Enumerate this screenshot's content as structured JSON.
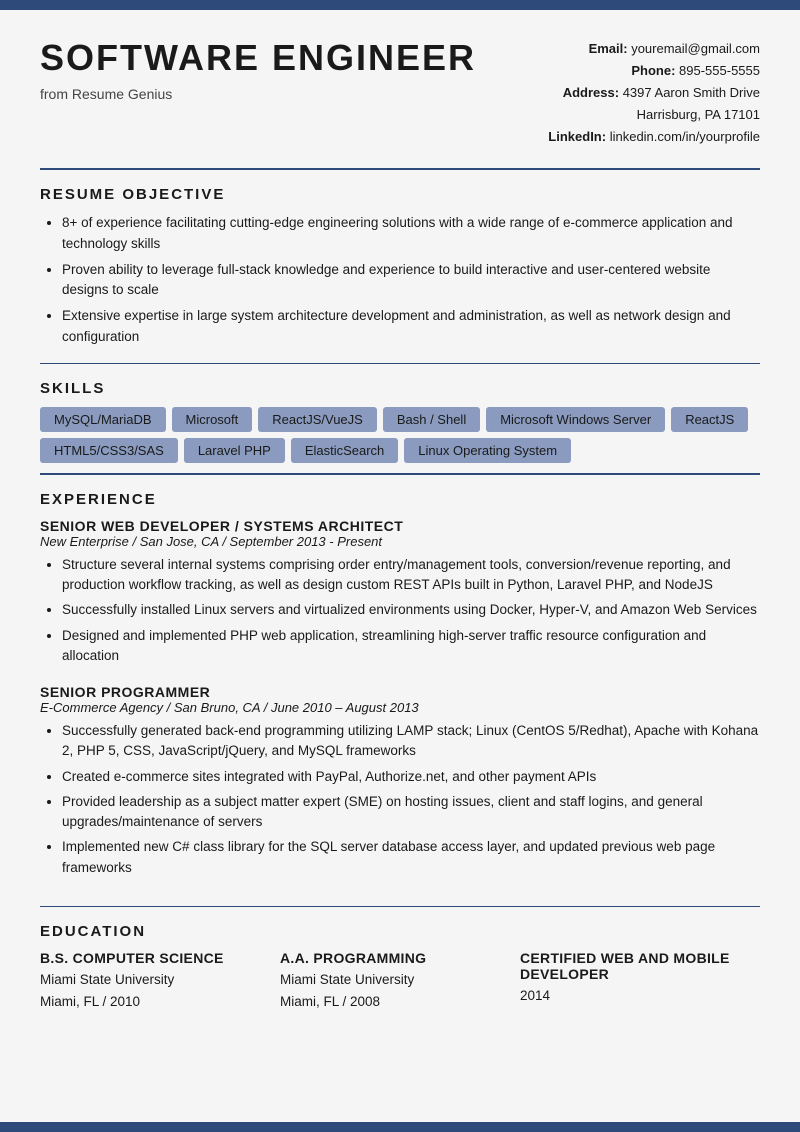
{
  "header": {
    "name": "SOFTWARE ENGINEER",
    "subtitle": "from Resume Genius",
    "contact": {
      "email_label": "Email:",
      "email_value": "youremail@gmail.com",
      "phone_label": "Phone:",
      "phone_value": "895-555-5555",
      "address_label": "Address:",
      "address_line1": "4397 Aaron Smith Drive",
      "address_line2": "Harrisburg, PA 17101",
      "linkedin_label": "LinkedIn:",
      "linkedin_value": "linkedin.com/in/yourprofile"
    }
  },
  "objective": {
    "section_title": "RESUME OBJECTIVE",
    "bullets": [
      "8+ of experience facilitating cutting-edge engineering solutions with a wide range of e-commerce application and technology skills",
      "Proven ability to leverage full-stack knowledge and experience to build interactive and user-centered website designs to scale",
      "Extensive expertise in large system architecture development and administration, as well as network design and configuration"
    ]
  },
  "skills": {
    "section_title": "SKILLS",
    "items": [
      "MySQL/MariaDB",
      "Microsoft",
      "ReactJS/VueJS",
      "Bash / Shell",
      "Microsoft Windows Server",
      "ReactJS",
      "HTML5/CSS3/SAS",
      "Laravel PHP",
      "ElasticSearch",
      "Linux Operating System"
    ]
  },
  "experience": {
    "section_title": "EXPERIENCE",
    "jobs": [
      {
        "title": "SENIOR WEB DEVELOPER / SYSTEMS ARCHITECT",
        "company_meta": "New Enterprise / San Jose, CA / September 2013 - Present",
        "bullets": [
          "Structure several internal systems comprising order entry/management tools, conversion/revenue reporting, and production workflow tracking, as well as design custom REST APIs built in Python, Laravel PHP, and NodeJS",
          "Successfully installed Linux servers and virtualized environments using Docker, Hyper-V, and Amazon Web Services",
          "Designed and implemented PHP web application, streamlining high-server traffic resource configuration and allocation"
        ]
      },
      {
        "title": "SENIOR PROGRAMMER",
        "company_meta": "E-Commerce Agency / San Bruno, CA / June 2010 – August 2013",
        "bullets": [
          "Successfully generated back-end programming utilizing LAMP stack; Linux (CentOS 5/Redhat), Apache with Kohana 2, PHP 5, CSS, JavaScript/jQuery, and MySQL frameworks",
          "Created e-commerce sites integrated with PayPal, Authorize.net, and other payment APIs",
          "Provided leadership as a subject matter expert (SME) on hosting issues, client and staff logins, and general upgrades/maintenance of servers",
          "Implemented new C# class library for the SQL server database access layer, and updated previous web page frameworks"
        ]
      }
    ]
  },
  "education": {
    "section_title": "EDUCATION",
    "items": [
      {
        "degree": "B.S. COMPUTER SCIENCE",
        "school": "Miami State University",
        "location_year": "Miami, FL / 2010"
      },
      {
        "degree": "A.A. PROGRAMMING",
        "school": "Miami State University",
        "location_year": "Miami, FL / 2008"
      },
      {
        "degree": "CERTIFIED WEB AND MOBILE DEVELOPER",
        "school": "",
        "location_year": "2014"
      }
    ]
  }
}
